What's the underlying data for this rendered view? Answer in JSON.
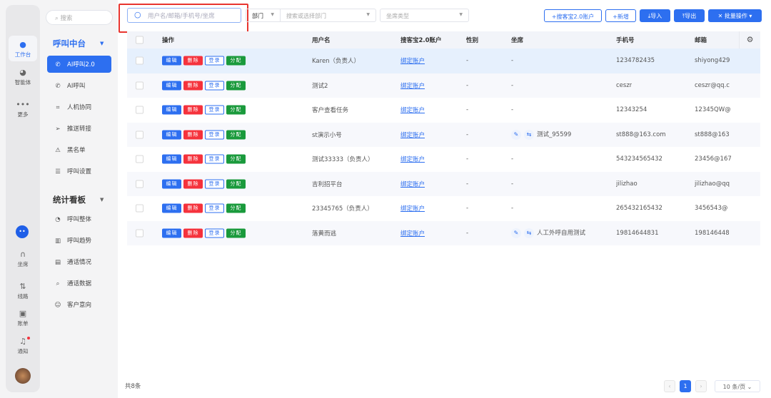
{
  "rail": {
    "items": [
      {
        "label": "工作台",
        "icon": "robot-icon"
      },
      {
        "label": "智能体",
        "icon": "agent-icon"
      },
      {
        "label": "更多",
        "icon": "more-icon"
      },
      {
        "label": "坐席",
        "icon": "headset-icon"
      },
      {
        "label": "线路",
        "icon": "route-icon"
      },
      {
        "label": "账单",
        "icon": "bill-icon"
      },
      {
        "label": "通知",
        "icon": "bell-icon"
      }
    ]
  },
  "sidebar": {
    "search_placeholder": "搜索",
    "section1": "呼叫中台",
    "items1": [
      {
        "label": "AI呼叫2.0",
        "icon": "phone-ai-icon"
      },
      {
        "label": "AI呼叫",
        "icon": "phone-icon"
      },
      {
        "label": "人机协同",
        "icon": "human-machine-icon"
      },
      {
        "label": "推送转接",
        "icon": "send-icon"
      },
      {
        "label": "黑名单",
        "icon": "warning-icon"
      },
      {
        "label": "呼叫设置",
        "icon": "sliders-icon"
      }
    ],
    "section2": "统计看板",
    "items2": [
      {
        "label": "呼叫整体",
        "icon": "pie-icon"
      },
      {
        "label": "呼叫趋势",
        "icon": "bar-chart-icon"
      },
      {
        "label": "通话情况",
        "icon": "doc-icon"
      },
      {
        "label": "通话数据",
        "icon": "doc-search-icon"
      },
      {
        "label": "客户意向",
        "icon": "smile-icon"
      }
    ]
  },
  "toolbar": {
    "search_placeholder": "用户名/邮箱/手机号/坐席",
    "dept_label": "部门",
    "dept_placeholder": "搜索或选择部门",
    "seat_type_placeholder": "坐席类型",
    "btn_bind": "+搜客宝2.0账户",
    "btn_add": "+新增",
    "btn_import": "导入",
    "btn_export": "导出",
    "btn_batch": "批量操作"
  },
  "table": {
    "headers": {
      "ops": "操作",
      "username": "用户名",
      "account": "搜客宝2.0账户",
      "gender": "性别",
      "seat": "坐席",
      "phone": "手机号",
      "email": "邮箱"
    },
    "op_labels": {
      "edit": "编辑",
      "delete": "删除",
      "login": "登录",
      "assign": "分配"
    },
    "rows": [
      {
        "username": "Karen（负责人）",
        "account": "绑定账户",
        "gender": "-",
        "seat": "-",
        "phone": "1234782435",
        "email": "shiyong429"
      },
      {
        "username": "测试2",
        "account": "绑定账户",
        "gender": "-",
        "seat": "-",
        "phone": "ceszr",
        "email": "ceszr@qq.c"
      },
      {
        "username": "客户查看任务",
        "account": "绑定账户",
        "gender": "-",
        "seat": "-",
        "phone": "12343254",
        "email": "12345QW@"
      },
      {
        "username": "st演示小号",
        "account": "绑定账户",
        "gender": "-",
        "seat": "测试_95599",
        "phone": "st888@163.com",
        "email": "st888@163"
      },
      {
        "username": "测试33333（负责人）",
        "account": "绑定账户",
        "gender": "-",
        "seat": "-",
        "phone": "543234565432",
        "email": "23456@167"
      },
      {
        "username": "吉利招平台",
        "account": "绑定账户",
        "gender": "-",
        "seat": "-",
        "phone": "jilizhao",
        "email": "jilizhao@qq"
      },
      {
        "username": "23345765（负责人）",
        "account": "绑定账户",
        "gender": "-",
        "seat": "-",
        "phone": "265432165432",
        "email": "3456543@"
      },
      {
        "username": "落黄而逃",
        "account": "绑定账户",
        "gender": "-",
        "seat": "人工外呼自用测试",
        "phone": "19814644831",
        "email": "198146448"
      }
    ]
  },
  "footer": {
    "total": "共8条",
    "page": "1",
    "page_size": "10 条/页"
  }
}
